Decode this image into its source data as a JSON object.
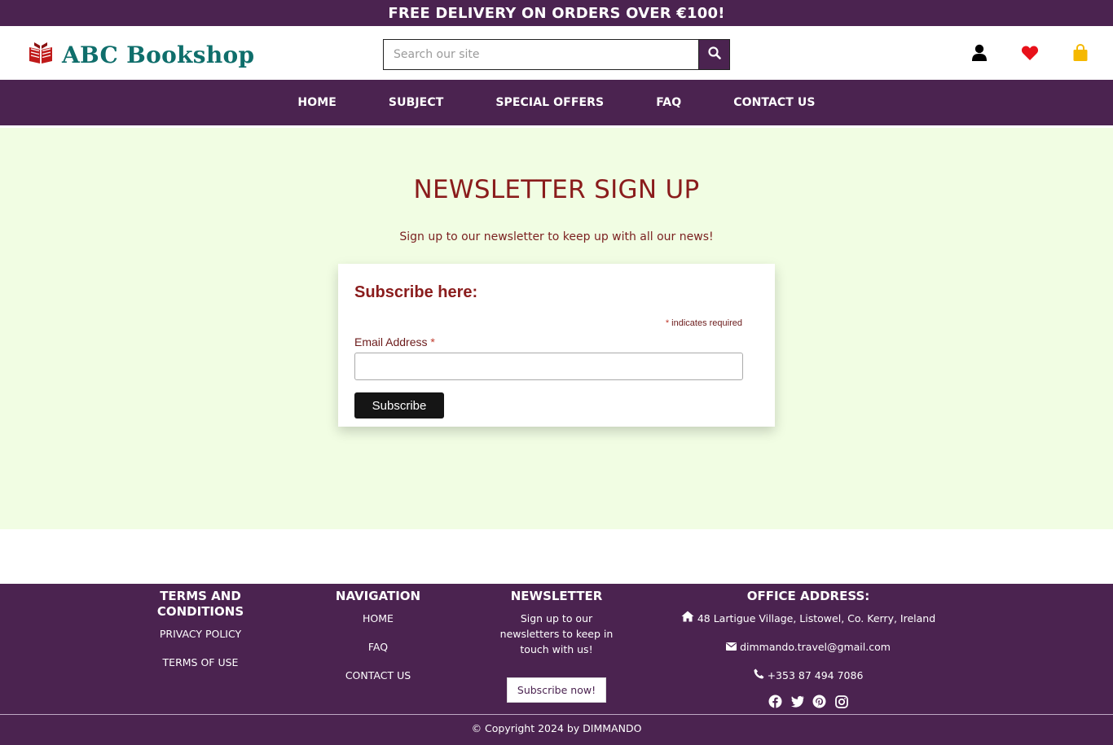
{
  "topbar": {
    "text": "FREE DELIVERY ON ORDERS OVER €100!"
  },
  "header": {
    "logo_text": "ABC Bookshop",
    "search_placeholder": "Search our site",
    "icons": [
      "search-icon",
      "user-icon",
      "heart-icon",
      "shopping-bag-icon"
    ]
  },
  "nav": {
    "items": [
      "HOME",
      "SUBJECT",
      "SPECIAL OFFERS",
      "FAQ",
      "CONTACT US"
    ]
  },
  "main": {
    "title": "NEWSLETTER SIGN UP",
    "lead": "Sign up to our newsletter to keep up with all our news!",
    "form": {
      "heading": "Subscribe here:",
      "required_asterisk": "*",
      "required_note": "indicates required",
      "email_label": "Email Address",
      "email_value": "",
      "subscribe_label": "Subscribe"
    }
  },
  "footer": {
    "terms": {
      "heading": "TERMS AND CONDITIONS",
      "links": [
        "PRIVACY POLICY",
        "TERMS OF USE"
      ]
    },
    "navigation": {
      "heading": "NAVIGATION",
      "links": [
        "HOME",
        "FAQ",
        "CONTACT US"
      ]
    },
    "newsletter": {
      "heading": "NEWSLETTER",
      "text": "Sign up to our newsletters to keep in touch with us!",
      "button": "Subscribe now!"
    },
    "office": {
      "heading": "OFFICE ADDRESS:",
      "address": "48 Lartigue Village, Listowel, Co. Kerry, Ireland",
      "email": "dimmando.travel@gmail.com",
      "phone": "+353 87 494 7086",
      "socials": [
        "facebook-icon",
        "twitter-icon",
        "pinterest-icon",
        "instagram-icon"
      ]
    },
    "copyright": "© Copyright 2024 by DIMMANDO"
  },
  "colors": {
    "brand_purple": "#4b2350",
    "accent_red": "#8a1c1c",
    "logo_teal": "#0f6e6b",
    "main_bg": "#f1fde3",
    "heart": "#e8111a",
    "bag": "#f5b800"
  }
}
